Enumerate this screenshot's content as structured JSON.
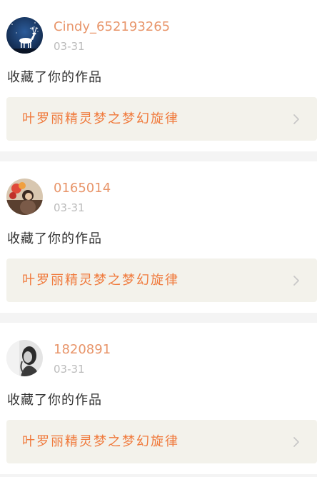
{
  "notifications": [
    {
      "username": "Cindy_652193265",
      "date": "03-31",
      "action": "收藏了你的作品",
      "work_title": "叶罗丽精灵梦之梦幻旋律",
      "avatar": "deer-night-avatar"
    },
    {
      "username": "0165014",
      "date": "03-31",
      "action": "收藏了你的作品",
      "work_title": "叶罗丽精灵梦之梦幻旋律",
      "avatar": "balloon-girl-avatar"
    },
    {
      "username": "1820891",
      "date": "03-31",
      "action": "收藏了你的作品",
      "work_title": "叶罗丽精灵梦之梦幻旋律",
      "avatar": "bw-portrait-avatar"
    }
  ],
  "colors": {
    "username": "#e8956a",
    "work_title": "#f07a3c",
    "date": "#bbbbbb",
    "action": "#333333",
    "link_bg": "#f3f2eb",
    "separator": "#f4f4f4"
  },
  "icons": {
    "chevron": "chevron-right-icon"
  }
}
